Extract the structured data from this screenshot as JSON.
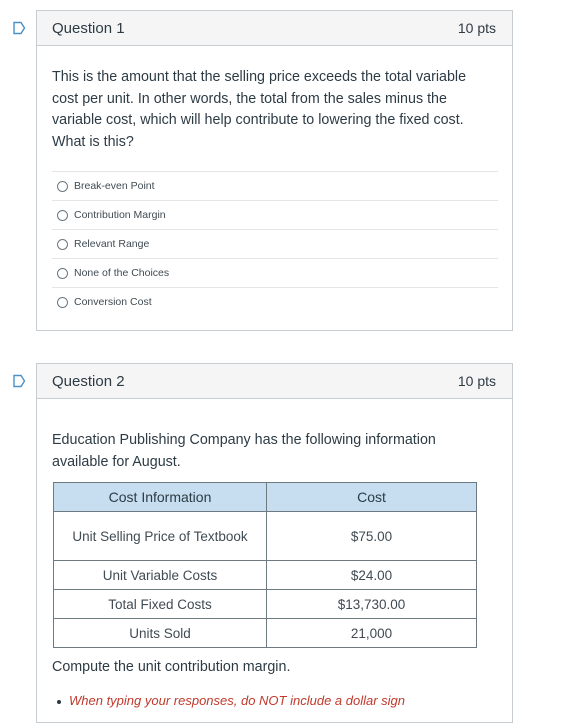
{
  "q1": {
    "title": "Question 1",
    "points": "10 pts",
    "text": "This is the amount that the selling price exceeds the total variable cost per unit. In other words, the total from the sales minus the variable cost, which will help contribute to lowering the fixed cost. What is this?",
    "options": [
      "Break-even Point",
      "Contribution Margin",
      "Relevant Range",
      "None of the Choices",
      "Conversion Cost"
    ]
  },
  "q2": {
    "title": "Question 2",
    "points": "10 pts",
    "intro": "Education Publishing Company has the following information available for August.",
    "table": {
      "headers": [
        "Cost Information",
        "Cost"
      ],
      "rows": [
        [
          "Unit Selling Price of Textbook",
          "$75.00"
        ],
        [
          "Unit Variable Costs",
          "$24.00"
        ],
        [
          "Total Fixed Costs",
          "$13,730.00"
        ],
        [
          "Units Sold",
          "21,000"
        ]
      ]
    },
    "prompt": "Compute the unit contribution margin.",
    "instruction": "When typing your responses, do NOT include a dollar sign"
  },
  "colors": {
    "flag": "#4a90c8",
    "header_bg": "#f5f5f5",
    "table_header_bg": "#c6def0",
    "instruction": "#c0392b"
  },
  "icons": {
    "flag": "bookmark-flag-icon",
    "radio": "radio-button-icon"
  }
}
